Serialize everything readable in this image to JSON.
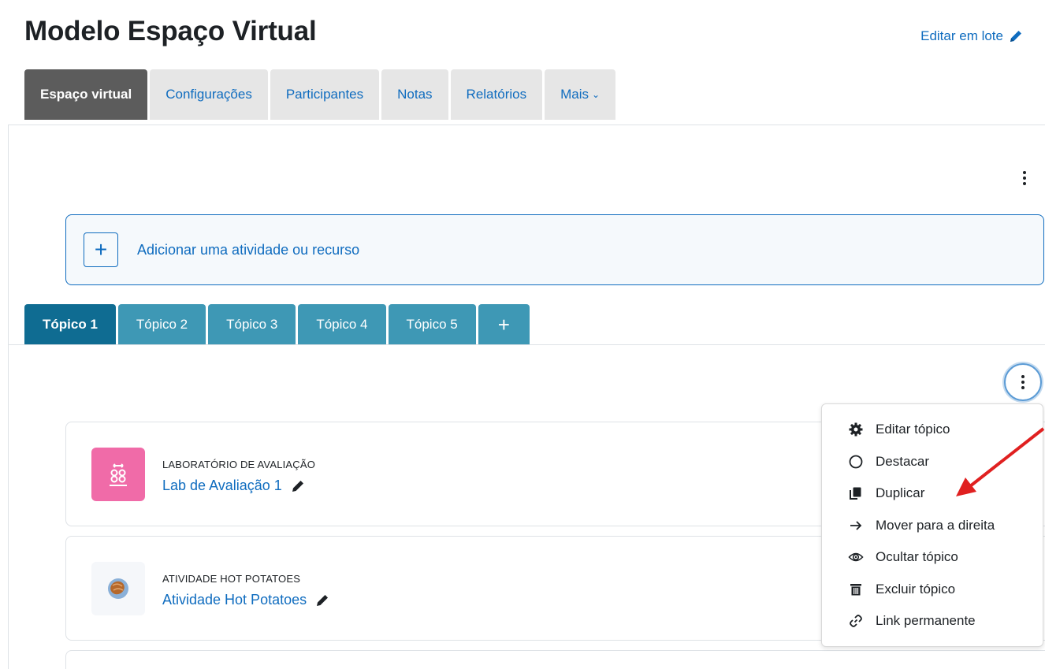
{
  "header": {
    "title": "Modelo Espaço Virtual",
    "bulk_edit_label": "Editar em lote"
  },
  "main_tabs": [
    {
      "label": "Espaço virtual",
      "active": true
    },
    {
      "label": "Configurações"
    },
    {
      "label": "Participantes"
    },
    {
      "label": "Notas"
    },
    {
      "label": "Relatórios"
    },
    {
      "label": "Mais"
    }
  ],
  "add_activity": {
    "label": "Adicionar uma atividade ou recurso"
  },
  "topic_tabs": [
    {
      "label": "Tópico 1",
      "active": true
    },
    {
      "label": "Tópico 2"
    },
    {
      "label": "Tópico 3"
    },
    {
      "label": "Tópico 4"
    },
    {
      "label": "Tópico 5"
    },
    {
      "label": "+"
    }
  ],
  "activities": [
    {
      "type": "LABORATÓRIO DE AVALIAÇÃO",
      "name": "Lab de Avaliação 1",
      "icon": "workshop-icon",
      "icon_bg": "#f06ba8"
    },
    {
      "type": "ATIVIDADE HOT POTATOES",
      "name": "Atividade Hot Potatoes",
      "icon": "hot-potatoes-icon",
      "icon_bg": "#f5f7fa"
    }
  ],
  "section_menu": {
    "items": [
      {
        "label": "Editar tópico",
        "icon": "gear-icon"
      },
      {
        "label": "Destacar",
        "icon": "circle-icon"
      },
      {
        "label": "Duplicar",
        "icon": "copy-icon"
      },
      {
        "label": "Mover para a direita",
        "icon": "arrow-right-icon"
      },
      {
        "label": "Ocultar tópico",
        "icon": "eye-icon"
      },
      {
        "label": "Excluir tópico",
        "icon": "trash-icon"
      },
      {
        "label": "Link permanente",
        "icon": "link-icon"
      }
    ]
  },
  "colors": {
    "link": "#0f6cbf",
    "active_tab": "#5c5c5c",
    "topic_tab": "#3e98b5",
    "topic_tab_active": "#0f6c92",
    "annotation_arrow": "#e02020"
  }
}
